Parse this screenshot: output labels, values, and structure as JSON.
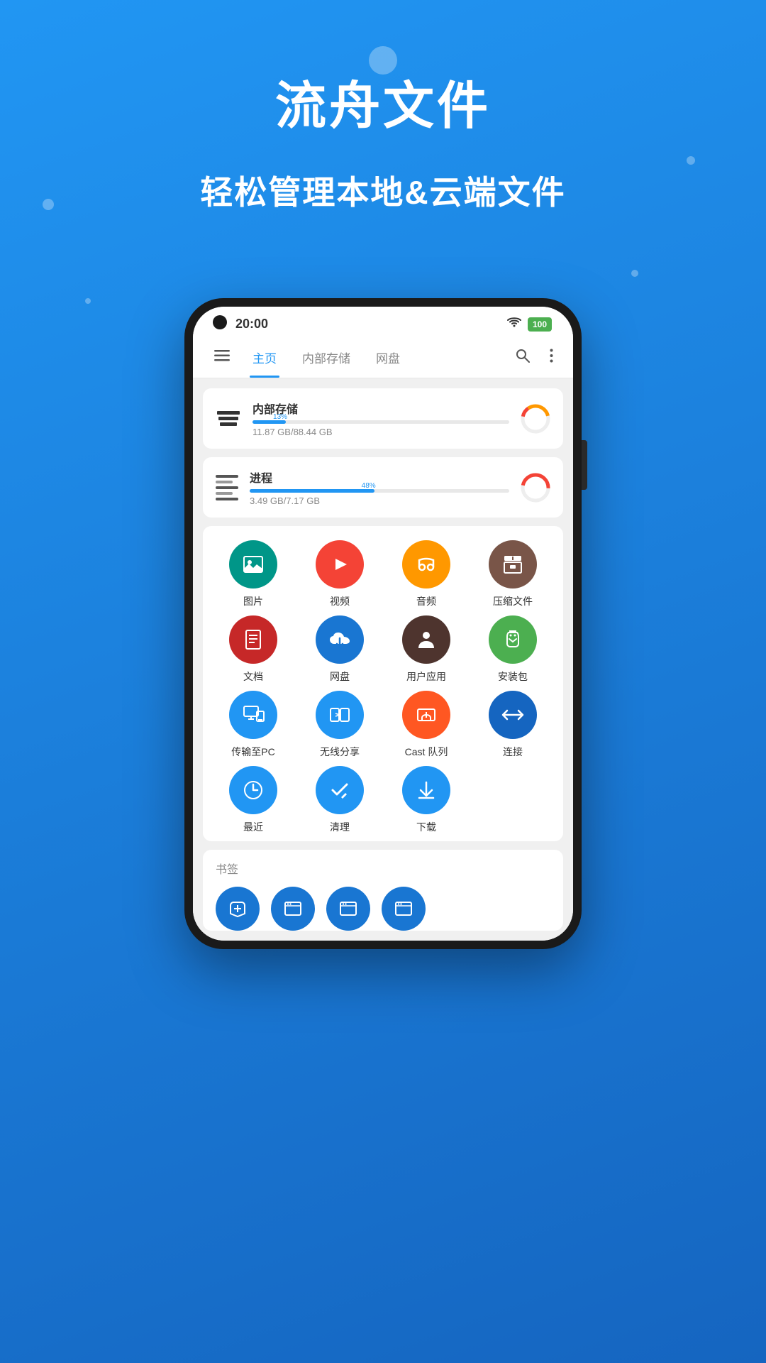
{
  "app": {
    "title": "流舟文件",
    "subtitle": "轻松管理本地&云端文件"
  },
  "phone": {
    "status_bar": {
      "time": "20:00",
      "battery": "100"
    },
    "nav": {
      "tabs": [
        {
          "label": "主页",
          "active": true
        },
        {
          "label": "内部存储",
          "active": false
        },
        {
          "label": "网盘",
          "active": false
        }
      ]
    },
    "storage_cards": [
      {
        "name": "内部存储",
        "progress_pct": 13,
        "progress_label": "13%",
        "size_info": "11.87 GB/88.44 GB"
      },
      {
        "name": "进程",
        "progress_pct": 48,
        "progress_label": "48%",
        "size_info": "3.49 GB/7.17 GB"
      }
    ],
    "icon_grid": [
      {
        "label": "图片",
        "color": "teal",
        "icon": "🖼"
      },
      {
        "label": "视频",
        "color": "red",
        "icon": "▶"
      },
      {
        "label": "音频",
        "color": "orange",
        "icon": "🎧"
      },
      {
        "label": "压缩文件",
        "color": "brown",
        "icon": "📥"
      },
      {
        "label": "文档",
        "color": "dark-red",
        "icon": "📄"
      },
      {
        "label": "网盘",
        "color": "blue",
        "icon": "☁"
      },
      {
        "label": "用户应用",
        "color": "dark-brown",
        "icon": "🤖"
      },
      {
        "label": "安装包",
        "color": "green",
        "icon": "🤖"
      },
      {
        "label": "传输至PC",
        "color": "blue2",
        "icon": "🖥"
      },
      {
        "label": "无线分享",
        "color": "blue2",
        "icon": "📱"
      },
      {
        "label": "Cast 队列",
        "color": "orange2",
        "icon": "📡"
      },
      {
        "label": "连接",
        "color": "blue3",
        "icon": "↔"
      },
      {
        "label": "最近",
        "color": "blue2",
        "icon": "🕐"
      },
      {
        "label": "清理",
        "color": "blue2",
        "icon": "✔"
      },
      {
        "label": "下载",
        "color": "blue2",
        "icon": "⬇"
      }
    ],
    "bookmarks": {
      "title": "书签",
      "items": [
        {
          "icon": "📥"
        },
        {
          "icon": "📁"
        },
        {
          "icon": "📁"
        },
        {
          "icon": "📁"
        }
      ]
    }
  }
}
